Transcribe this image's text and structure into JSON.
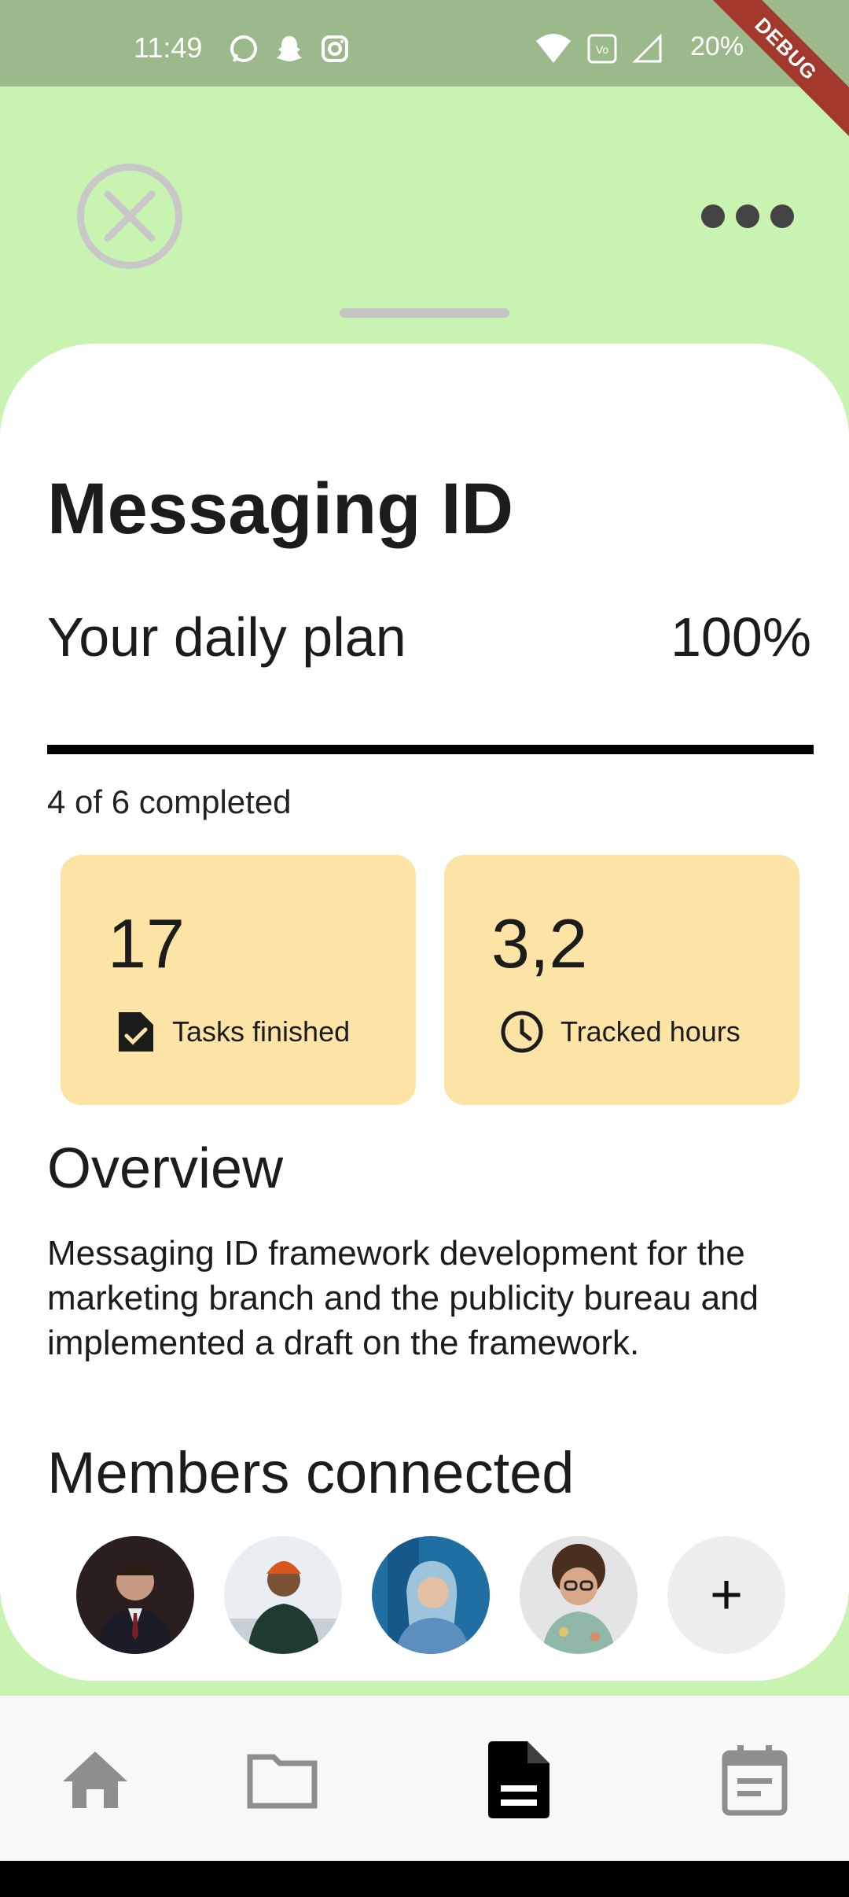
{
  "status_bar": {
    "time": "11:49",
    "battery": "20%",
    "debug_label": "DEBUG",
    "left_icons": [
      "whatsapp-icon",
      "snapchat-icon",
      "instagram-icon"
    ],
    "right_icons": [
      "wifi-icon",
      "volte-icon",
      "signal-icon"
    ]
  },
  "header": {
    "close_icon": "close-circle-icon",
    "more_icon": "more-horizontal-icon"
  },
  "project": {
    "title": "Messaging ID",
    "plan_label": "Your daily plan",
    "plan_percent": "100%",
    "progress": 1.0,
    "completed_text": "4 of 6 completed"
  },
  "stats": [
    {
      "value": "17",
      "label": "Tasks finished",
      "icon": "task-check-icon"
    },
    {
      "value": "3,2",
      "label": "Tracked hours",
      "icon": "clock-icon"
    }
  ],
  "overview": {
    "title": "Overview",
    "text": "Messaging ID framework development for the marketing branch and the publicity bureau and implemented a draft on the framework."
  },
  "members": {
    "title": "Members connected",
    "avatars": [
      "member-avatar-1",
      "member-avatar-2",
      "member-avatar-3",
      "member-avatar-4"
    ],
    "add_label": "+"
  },
  "bottom_nav": {
    "items": [
      "home-icon",
      "folder-icon",
      "document-icon",
      "calendar-icon"
    ],
    "active": "document-icon"
  },
  "colors": {
    "background": "#c9f3b0",
    "status_bar": "#9bb98a",
    "card": "#fce4a6",
    "progress": "#000000"
  }
}
